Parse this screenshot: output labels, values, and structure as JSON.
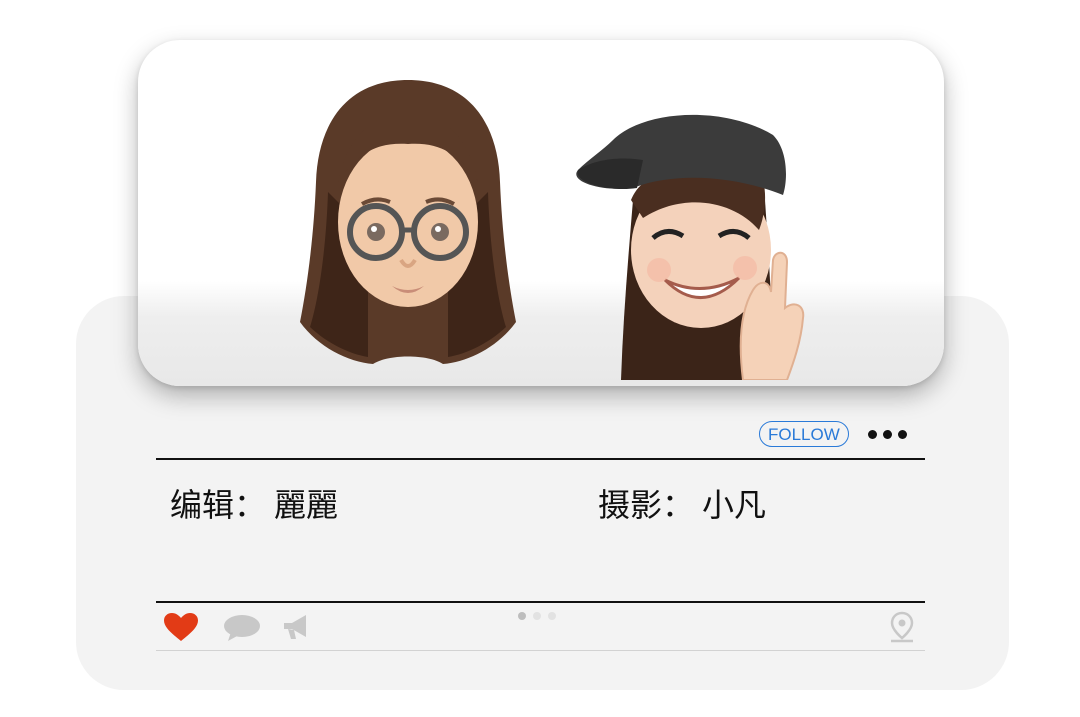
{
  "post": {
    "follow_label": "FOLLOW",
    "more_icon": "more-dots-icon",
    "credits": {
      "editor_label": "编辑：",
      "editor_name": "麗麗",
      "photographer_label": "摄影：",
      "photographer_name": "小凡"
    },
    "pager": {
      "count": 3,
      "active_index": 0,
      "active_color": "#bdbdbd",
      "inactive_color": "#e2e2e2"
    },
    "icons": {
      "like": "heart-icon",
      "comment": "comment-icon",
      "share": "megaphone-icon",
      "location": "location-pin-icon"
    },
    "colors": {
      "accent": "#2a7ad8",
      "like": "#e23b16",
      "icon_muted": "#c8c8c8",
      "card_bg": "#f3f3f3"
    }
  }
}
